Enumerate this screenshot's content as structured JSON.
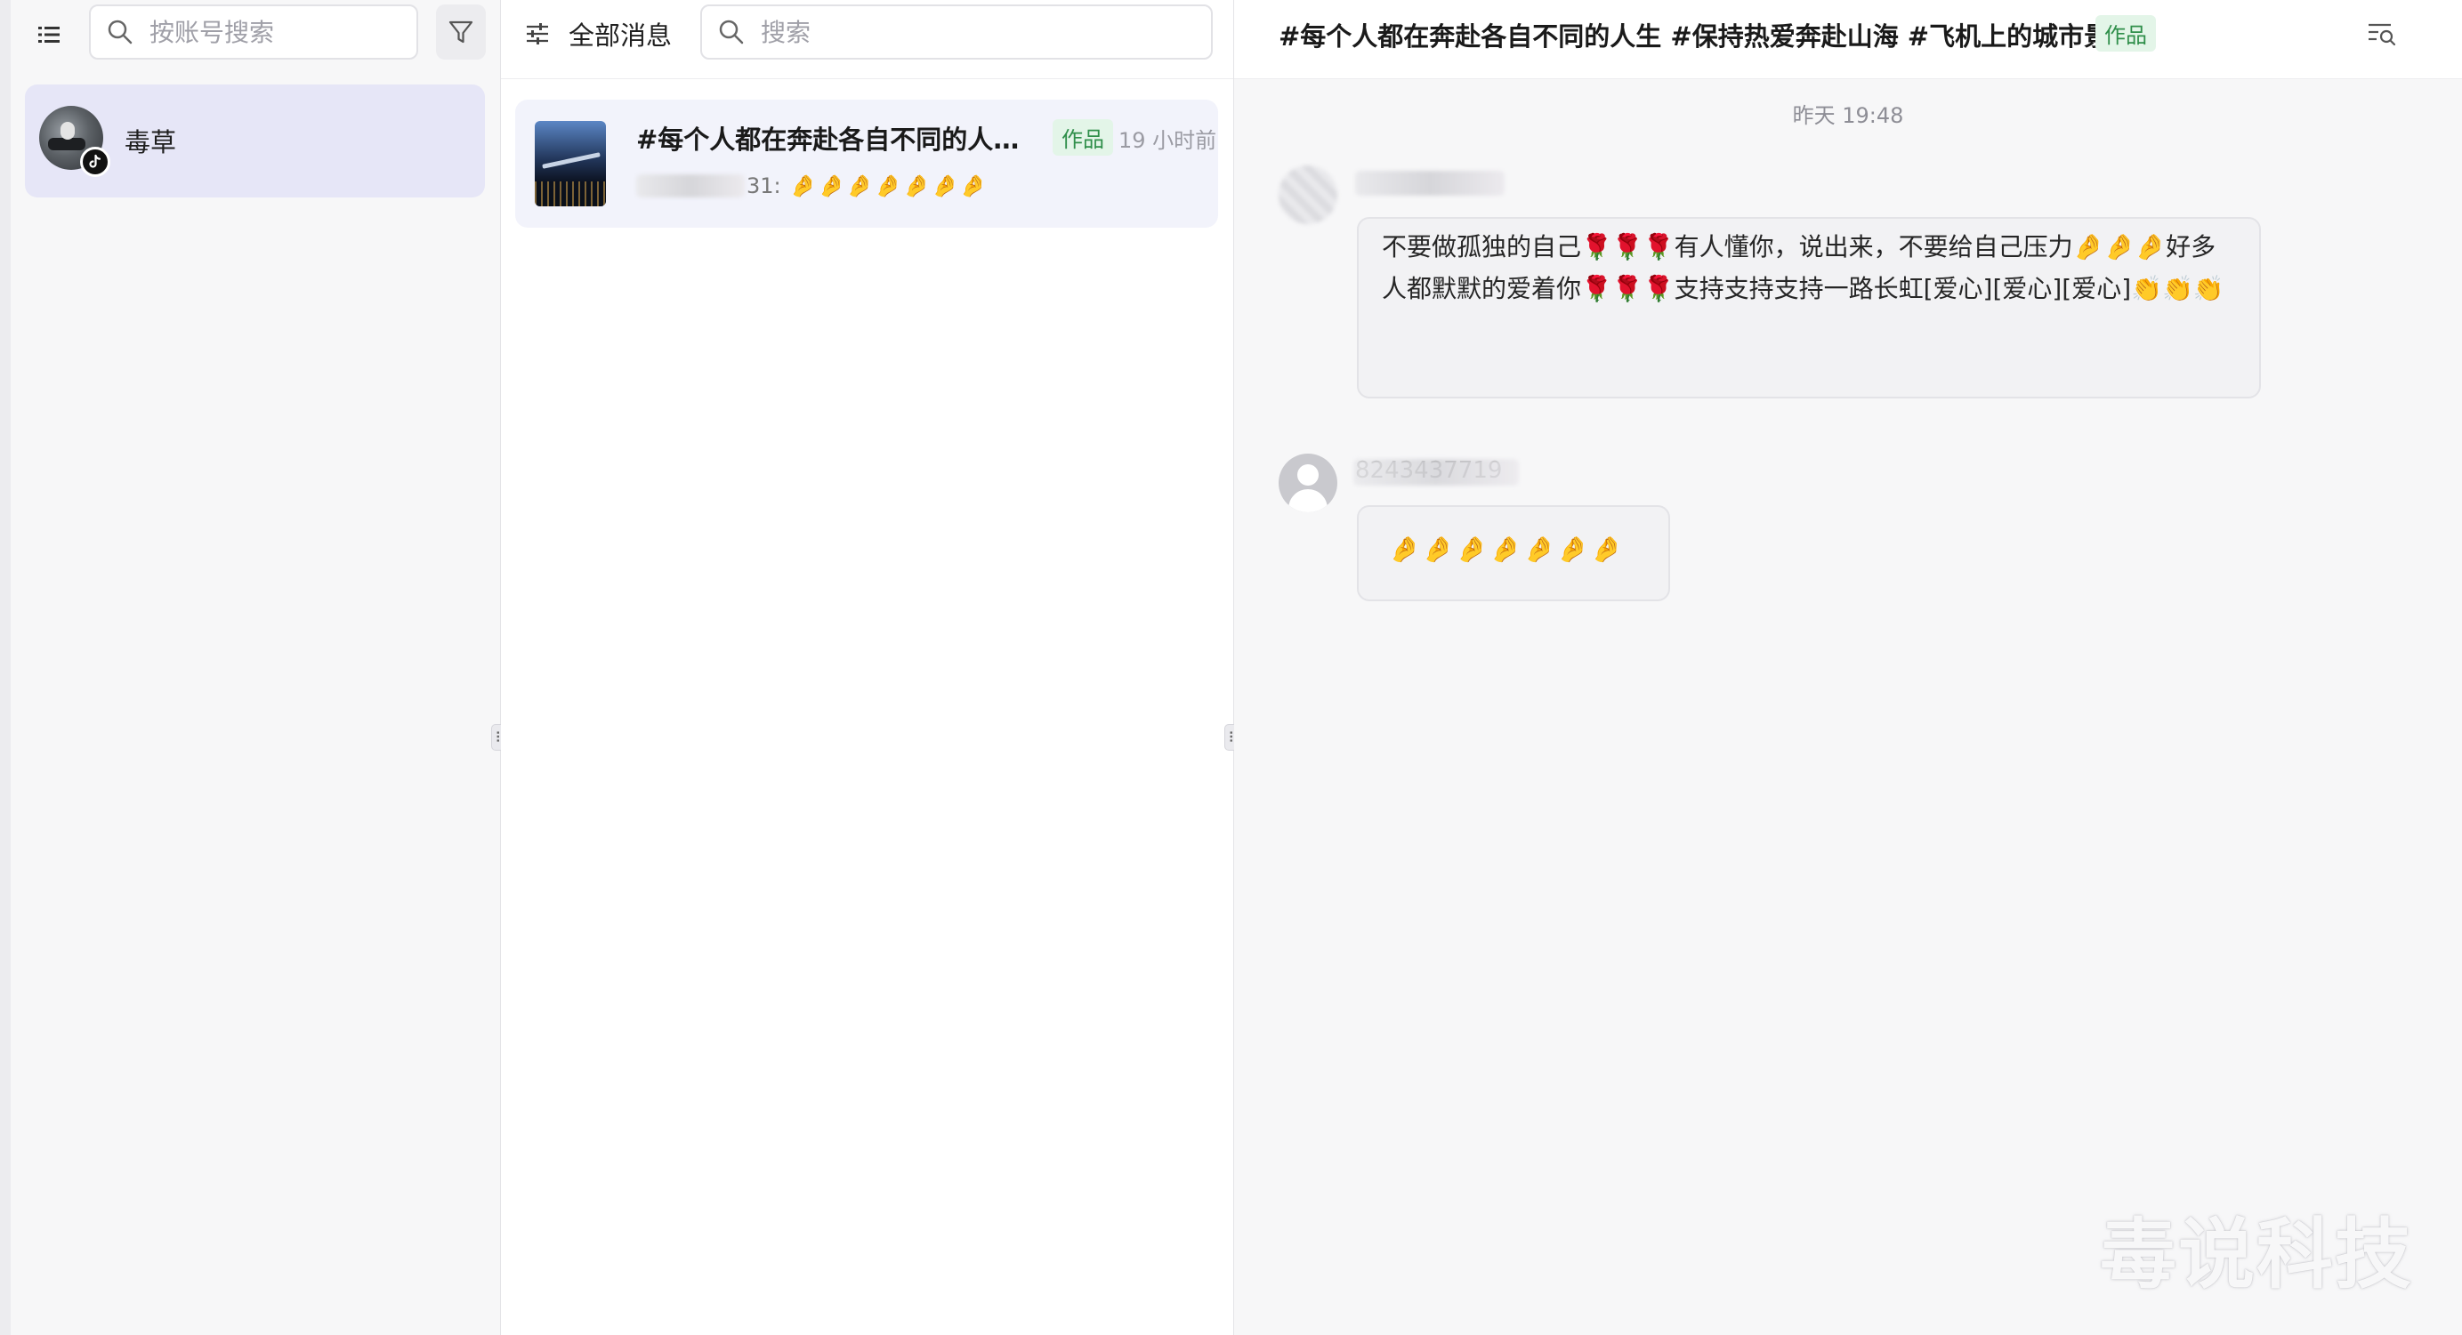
{
  "account_panel": {
    "search_placeholder": "按账号搜索",
    "accounts": [
      {
        "name": "毒草",
        "platform_badge": "tiktok-icon"
      }
    ]
  },
  "message_panel": {
    "filter_label": "全部消息",
    "search_placeholder": "搜索",
    "conversations": [
      {
        "title": "#每个人都在奔赴各自不同的人生 ...",
        "tag": "作品",
        "time": "19 小时前",
        "sender_tail": "31:",
        "preview_emojis": "🤌🤌🤌🤌🤌🤌🤌"
      }
    ]
  },
  "chat_panel": {
    "title": "#每个人都在奔赴各自不同的人生 #保持热爱奔赴山海 #飞机上的城市景色",
    "tag": "作品",
    "timestamp": "昨天 19:48",
    "messages": [
      {
        "text": "不要做孤独的自己🌹🌹🌹有人懂你，说出来，不要给自己压力🤌🤌🤌好多人都默默的爱着你🌹🌹🌹支持支持支持一路长虹[爱心][爱心][爱心]👏👏👏"
      },
      {
        "sender": "8243437719",
        "text": "🤌🤌🤌🤌🤌🤌🤌"
      }
    ]
  },
  "watermark": "毒说科技",
  "colors": {
    "selected_account_bg": "#e6e6f7",
    "selected_convo_bg": "#f2f3fb",
    "tag_bg": "#e3f5e8",
    "tag_text": "#2f8f4a"
  }
}
